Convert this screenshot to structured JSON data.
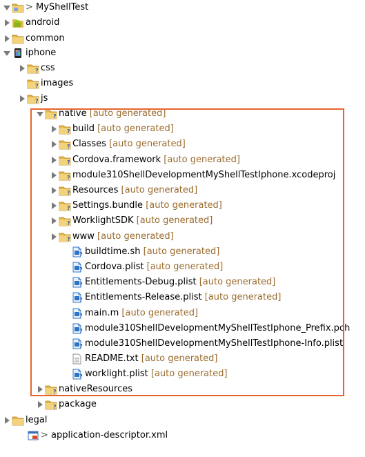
{
  "colors": {
    "highlight": "#e8632b",
    "decoration": "#9a6b2e",
    "folder": "#e5b74a",
    "file": "#2b74c7"
  },
  "nodes": [
    {
      "id": "n0",
      "prefix": "> ",
      "label": "MyShellTest",
      "decoration": "",
      "icon": "project-folder-icon",
      "twisty": "open"
    },
    {
      "id": "n1",
      "label": "android",
      "decoration": "",
      "icon": "android-folder-icon",
      "twisty": "closed"
    },
    {
      "id": "n2",
      "label": "common",
      "decoration": "",
      "icon": "folder-icon",
      "twisty": "closed"
    },
    {
      "id": "n3",
      "label": "iphone",
      "decoration": "",
      "icon": "iphone-folder-icon",
      "twisty": "open"
    },
    {
      "id": "n4",
      "label": "css",
      "decoration": "",
      "icon": "folder-unknown-icon",
      "twisty": "closed"
    },
    {
      "id": "n5",
      "label": "images",
      "decoration": "",
      "icon": "folder-unknown-icon",
      "twisty": "none"
    },
    {
      "id": "n6",
      "label": "js",
      "decoration": "",
      "icon": "folder-unknown-icon",
      "twisty": "closed"
    },
    {
      "id": "n7",
      "label": "native",
      "decoration": "[auto generated]",
      "icon": "folder-unknown-icon",
      "twisty": "open"
    },
    {
      "id": "n8",
      "label": "build",
      "decoration": "[auto generated]",
      "icon": "folder-unknown-icon",
      "twisty": "closed"
    },
    {
      "id": "n9",
      "label": "Classes",
      "decoration": "[auto generated]",
      "icon": "folder-unknown-icon",
      "twisty": "closed"
    },
    {
      "id": "n10",
      "label": "Cordova.framework",
      "decoration": "[auto generated]",
      "icon": "folder-unknown-icon",
      "twisty": "closed"
    },
    {
      "id": "n11",
      "label": "module310ShellDevelopmentMyShellTestIphone.xcodeproj",
      "decoration": "",
      "icon": "folder-unknown-icon",
      "twisty": "closed"
    },
    {
      "id": "n12",
      "label": "Resources",
      "decoration": "[auto generated]",
      "icon": "folder-unknown-icon",
      "twisty": "closed"
    },
    {
      "id": "n13",
      "label": "Settings.bundle",
      "decoration": "[auto generated]",
      "icon": "folder-unknown-icon",
      "twisty": "closed"
    },
    {
      "id": "n14",
      "label": "WorklightSDK",
      "decoration": "[auto generated]",
      "icon": "folder-unknown-icon",
      "twisty": "closed"
    },
    {
      "id": "n15",
      "label": "www",
      "decoration": "[auto generated]",
      "icon": "folder-unknown-icon",
      "twisty": "closed"
    },
    {
      "id": "n16",
      "label": "buildtime.sh",
      "decoration": "[auto generated]",
      "icon": "file-unknown-icon",
      "twisty": "none"
    },
    {
      "id": "n17",
      "label": "Cordova.plist",
      "decoration": "[auto generated]",
      "icon": "file-unknown-icon",
      "twisty": "none"
    },
    {
      "id": "n18",
      "label": "Entitlements-Debug.plist",
      "decoration": "[auto generated]",
      "icon": "file-unknown-icon",
      "twisty": "none"
    },
    {
      "id": "n19",
      "label": "Entitlements-Release.plist",
      "decoration": "[auto generated]",
      "icon": "file-unknown-icon",
      "twisty": "none"
    },
    {
      "id": "n20",
      "label": "main.m",
      "decoration": "[auto generated]",
      "icon": "file-unknown-icon",
      "twisty": "none"
    },
    {
      "id": "n21",
      "label": "module310ShellDevelopmentMyShellTestIphone_Prefix.pch",
      "decoration": "",
      "icon": "file-unknown-icon",
      "twisty": "none"
    },
    {
      "id": "n22",
      "label": "module310ShellDevelopmentMyShellTestIphone-Info.plist",
      "decoration": "",
      "icon": "file-unknown-icon",
      "twisty": "none"
    },
    {
      "id": "n23",
      "label": "README.txt",
      "decoration": "[auto generated]",
      "icon": "text-file-icon",
      "twisty": "none"
    },
    {
      "id": "n24",
      "label": "worklight.plist",
      "decoration": "[auto generated]",
      "icon": "file-unknown-icon",
      "twisty": "none"
    },
    {
      "id": "n25",
      "label": "nativeResources",
      "decoration": "",
      "icon": "folder-unknown-icon",
      "twisty": "closed"
    },
    {
      "id": "n26",
      "label": "package",
      "decoration": "",
      "icon": "folder-unknown-icon",
      "twisty": "closed"
    },
    {
      "id": "n27",
      "label": "legal",
      "decoration": "",
      "icon": "folder-icon",
      "twisty": "closed"
    },
    {
      "id": "n28",
      "prefix": "> ",
      "label": "application-descriptor.xml",
      "decoration": "",
      "icon": "xml-file-icon",
      "twisty": "none"
    }
  ]
}
